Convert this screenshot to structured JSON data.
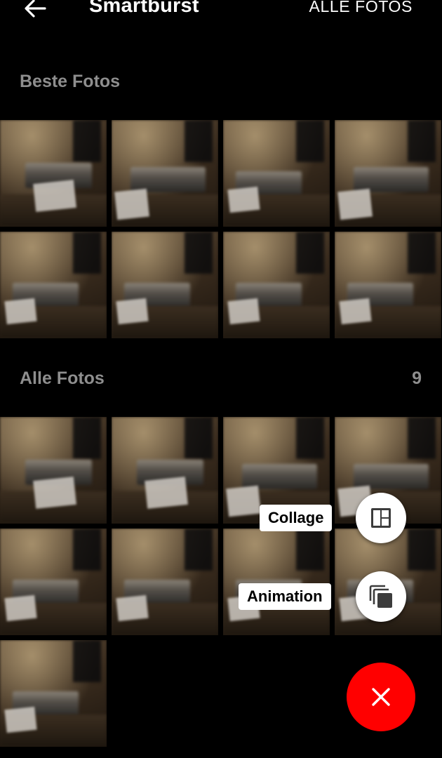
{
  "appbar": {
    "back_icon": "arrow-left-icon",
    "title": "Smartburst",
    "all_photos_label": "ALLE FOTOS"
  },
  "best_section": {
    "heading": "Beste Fotos",
    "photos": [
      "burst-photo",
      "burst-photo",
      "burst-photo",
      "burst-photo",
      "burst-photo",
      "burst-photo",
      "burst-photo",
      "burst-photo"
    ]
  },
  "all_section": {
    "heading": "Alle Fotos",
    "count": "9",
    "photos": [
      "burst-photo",
      "burst-photo",
      "burst-photo",
      "burst-photo",
      "burst-photo",
      "burst-photo",
      "burst-photo",
      "burst-photo",
      "burst-photo"
    ]
  },
  "speed_dial": {
    "collage_label": "Collage",
    "collage_icon": "collage-layout-icon",
    "animation_label": "Animation",
    "animation_icon": "stacked-copies-icon",
    "close_icon": "close-icon",
    "fab_color": "#ff0000"
  }
}
